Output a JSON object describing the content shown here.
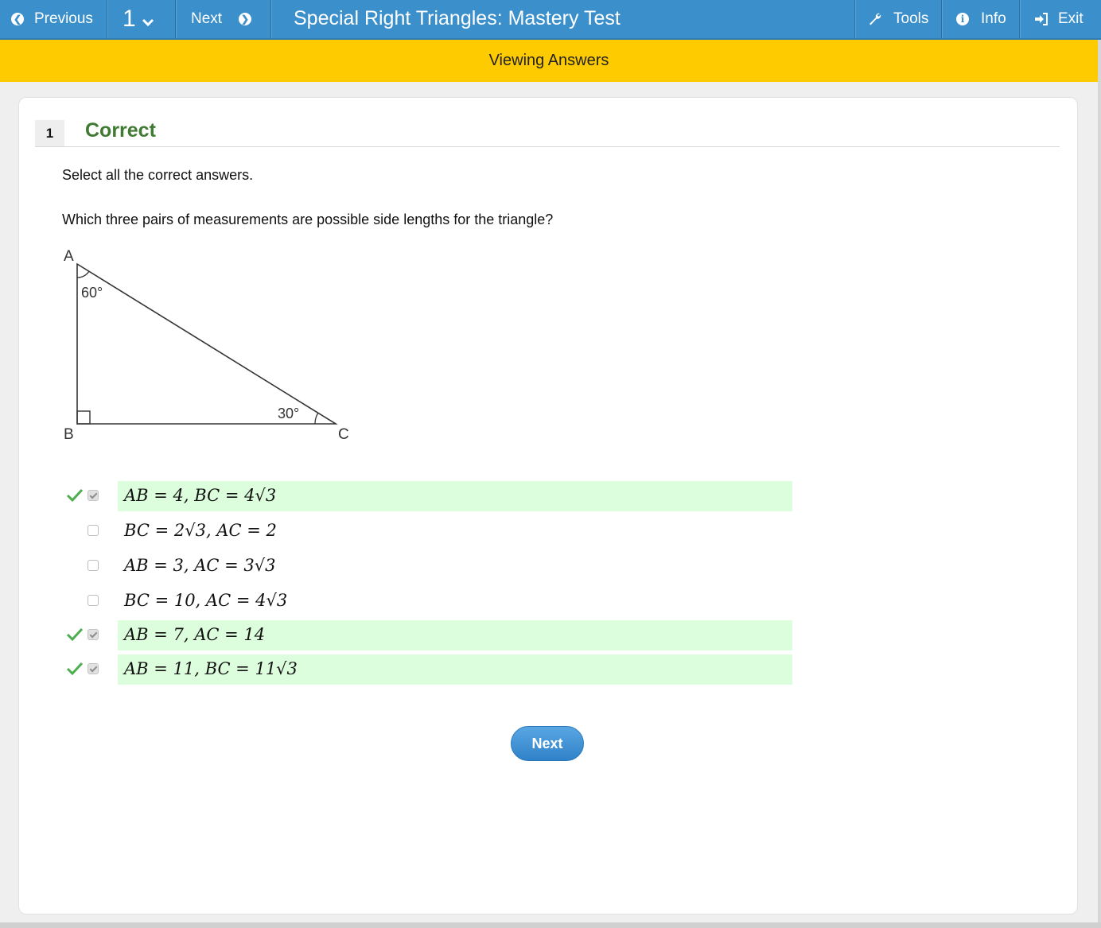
{
  "toolbar": {
    "previous_label": "Previous",
    "question_selector": "1",
    "next_label": "Next",
    "title": "Special Right Triangles: Mastery Test",
    "tools_label": "Tools",
    "info_label": "Info",
    "exit_label": "Exit"
  },
  "banner": {
    "text": "Viewing Answers"
  },
  "question": {
    "number": "1",
    "status": "Correct",
    "instruction": "Select all the correct answers.",
    "prompt": "Which three pairs of measurements are possible side lengths for the triangle?"
  },
  "figure": {
    "vertex_a": "A",
    "vertex_b": "B",
    "vertex_c": "C",
    "angle_a": "60°",
    "angle_c": "30°"
  },
  "answers": [
    {
      "label": "AB = 4,  BC = 4√3",
      "checked": true,
      "correct": true
    },
    {
      "label": "BC = 2√3,  AC = 2",
      "checked": false,
      "correct": false
    },
    {
      "label": "AB = 3,  AC = 3√3",
      "checked": false,
      "correct": false
    },
    {
      "label": "BC = 10,  AC = 4√3",
      "checked": false,
      "correct": false
    },
    {
      "label": "AB = 7,  AC = 14",
      "checked": true,
      "correct": true
    },
    {
      "label": "AB = 11,  BC = 11√3",
      "checked": true,
      "correct": true
    }
  ],
  "next_button": "Next",
  "colors": {
    "toolbar": "#3b8fcb",
    "banner": "#fecb00",
    "correct_text": "#3f7a33",
    "correct_row": "#ddfedd",
    "check_mark": "#4cae4c"
  }
}
